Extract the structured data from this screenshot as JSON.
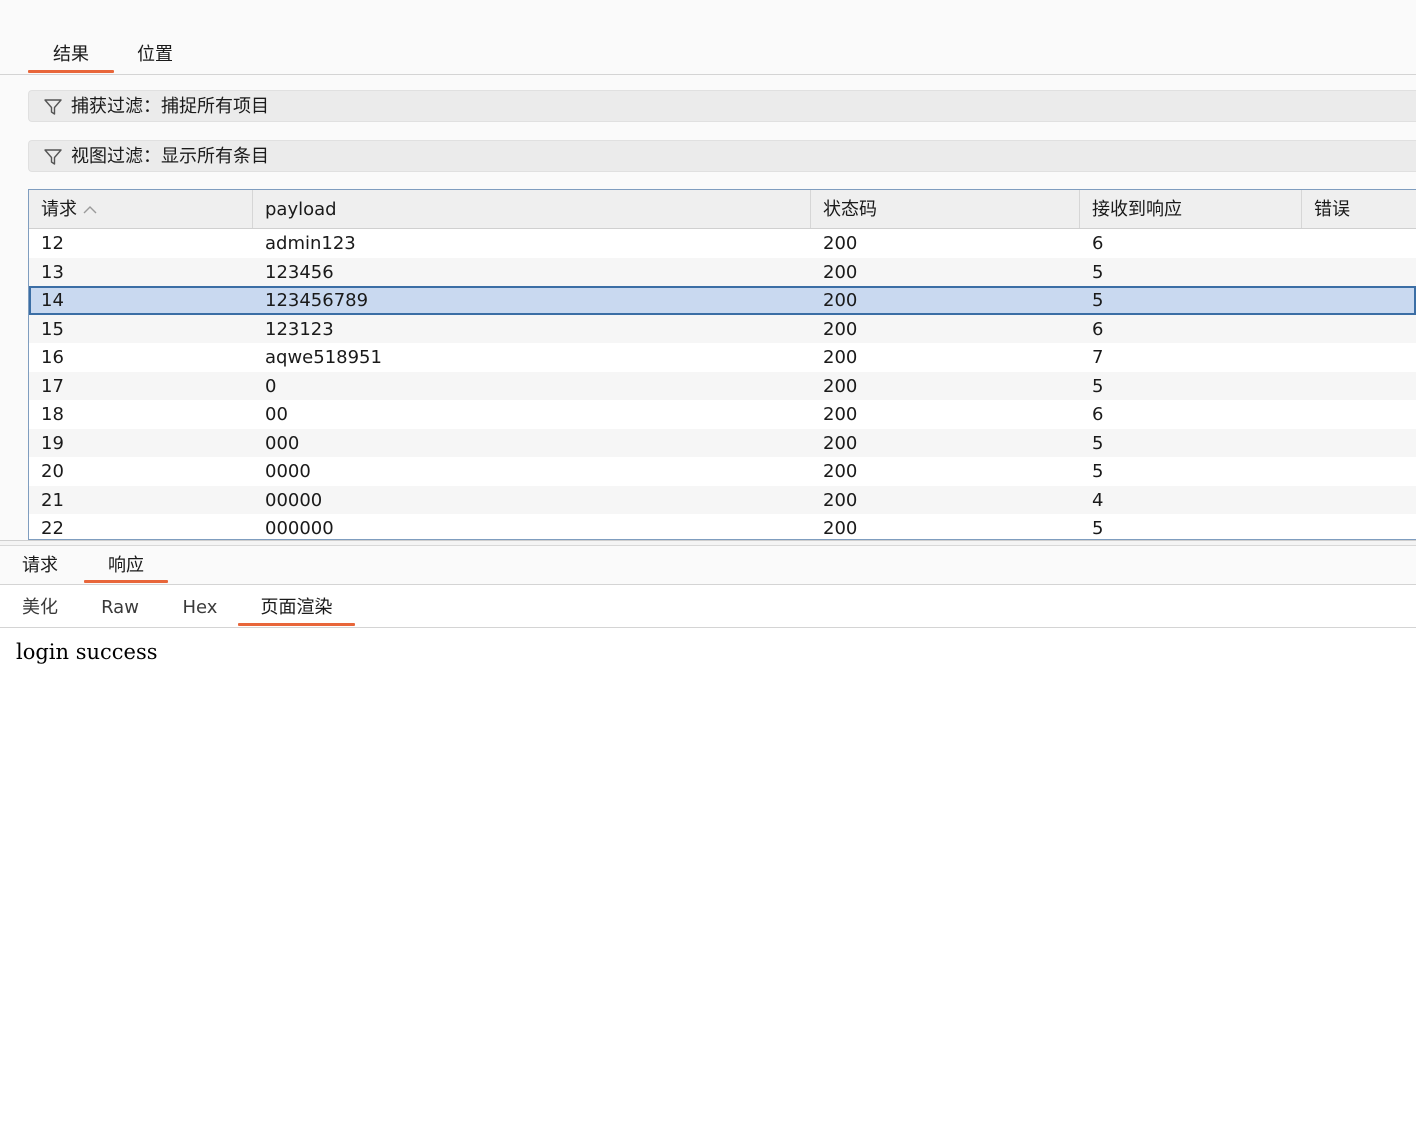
{
  "top_tabs": [
    {
      "label": "结果",
      "active": true
    },
    {
      "label": "位置",
      "active": false
    }
  ],
  "filters": {
    "capture": {
      "icon": "filter-icon",
      "label": "捕获过滤：捕捉所有项目"
    },
    "view": {
      "icon": "filter-icon",
      "label": "视图过滤：显示所有条目"
    }
  },
  "table": {
    "columns": [
      "请求",
      "payload",
      "状态码",
      "接收到响应",
      "错误"
    ],
    "sort": {
      "column": "请求",
      "direction": "ascending",
      "icon": "sort-up-icon"
    },
    "rows": [
      {
        "request": "12",
        "payload": "admin123",
        "status": "200",
        "received": "6",
        "error": ""
      },
      {
        "request": "13",
        "payload": "123456",
        "status": "200",
        "received": "5",
        "error": ""
      },
      {
        "request": "14",
        "payload": "123456789",
        "status": "200",
        "received": "5",
        "error": "",
        "selected": true
      },
      {
        "request": "15",
        "payload": "123123",
        "status": "200",
        "received": "6",
        "error": ""
      },
      {
        "request": "16",
        "payload": "aqwe518951",
        "status": "200",
        "received": "7",
        "error": ""
      },
      {
        "request": "17",
        "payload": "0",
        "status": "200",
        "received": "5",
        "error": ""
      },
      {
        "request": "18",
        "payload": "00",
        "status": "200",
        "received": "6",
        "error": ""
      },
      {
        "request": "19",
        "payload": "000",
        "status": "200",
        "received": "5",
        "error": ""
      },
      {
        "request": "20",
        "payload": "0000",
        "status": "200",
        "received": "5",
        "error": ""
      },
      {
        "request": "21",
        "payload": "00000",
        "status": "200",
        "received": "4",
        "error": ""
      },
      {
        "request": "22",
        "payload": "000000",
        "status": "200",
        "received": "5",
        "error": ""
      }
    ]
  },
  "detail_tabs": [
    {
      "label": "请求",
      "active": false
    },
    {
      "label": "响应",
      "active": true
    }
  ],
  "view_tabs": [
    {
      "label": "美化",
      "active": false
    },
    {
      "label": "Raw",
      "active": false
    },
    {
      "label": "Hex",
      "active": false
    },
    {
      "label": "页面渲染",
      "active": true
    }
  ],
  "rendered_page": {
    "text": "login success"
  },
  "colors": {
    "accent": "#e8663a",
    "selection": "#c9d9f0",
    "selection_border": "#3b6ea5"
  }
}
